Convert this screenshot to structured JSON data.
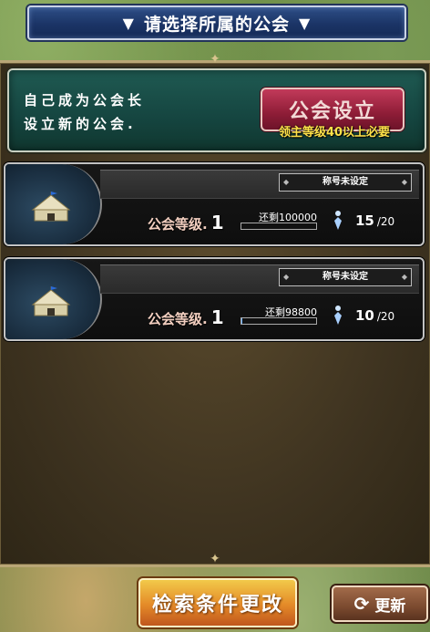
{
  "header": {
    "title": "请选择所属的公会",
    "arrow_left": "▼",
    "arrow_right": "▼"
  },
  "create": {
    "description_line1": "自己成为公会长",
    "description_line2": "设立新的公会.",
    "button_label": "公会设立",
    "requirement": "领主等级40以上必要"
  },
  "guilds": [
    {
      "title": "称号未设定",
      "level_label": "公会等级.",
      "level": "1",
      "remaining": "还剩100000",
      "progress_fraction": 0,
      "members": "15",
      "members_max": "/20"
    },
    {
      "title": "称号未设定",
      "level_label": "公会等级.",
      "level": "1",
      "remaining": "还剩98800",
      "progress_fraction": 0.012,
      "members": "10",
      "members_max": "/20"
    }
  ],
  "footer": {
    "search_button": "检索条件更改",
    "refresh_button": "更新"
  },
  "icons": {
    "guild_emblem": "tent-icon",
    "member": "member-icon",
    "refresh": "refresh-icon"
  },
  "colors": {
    "title_bar": "#1b3466",
    "create_panel": "#154540",
    "create_button": "#8e1d37",
    "requirement_text": "#ffe24a",
    "search_button": "#e48a28",
    "refresh_button": "#7b4a2f"
  }
}
